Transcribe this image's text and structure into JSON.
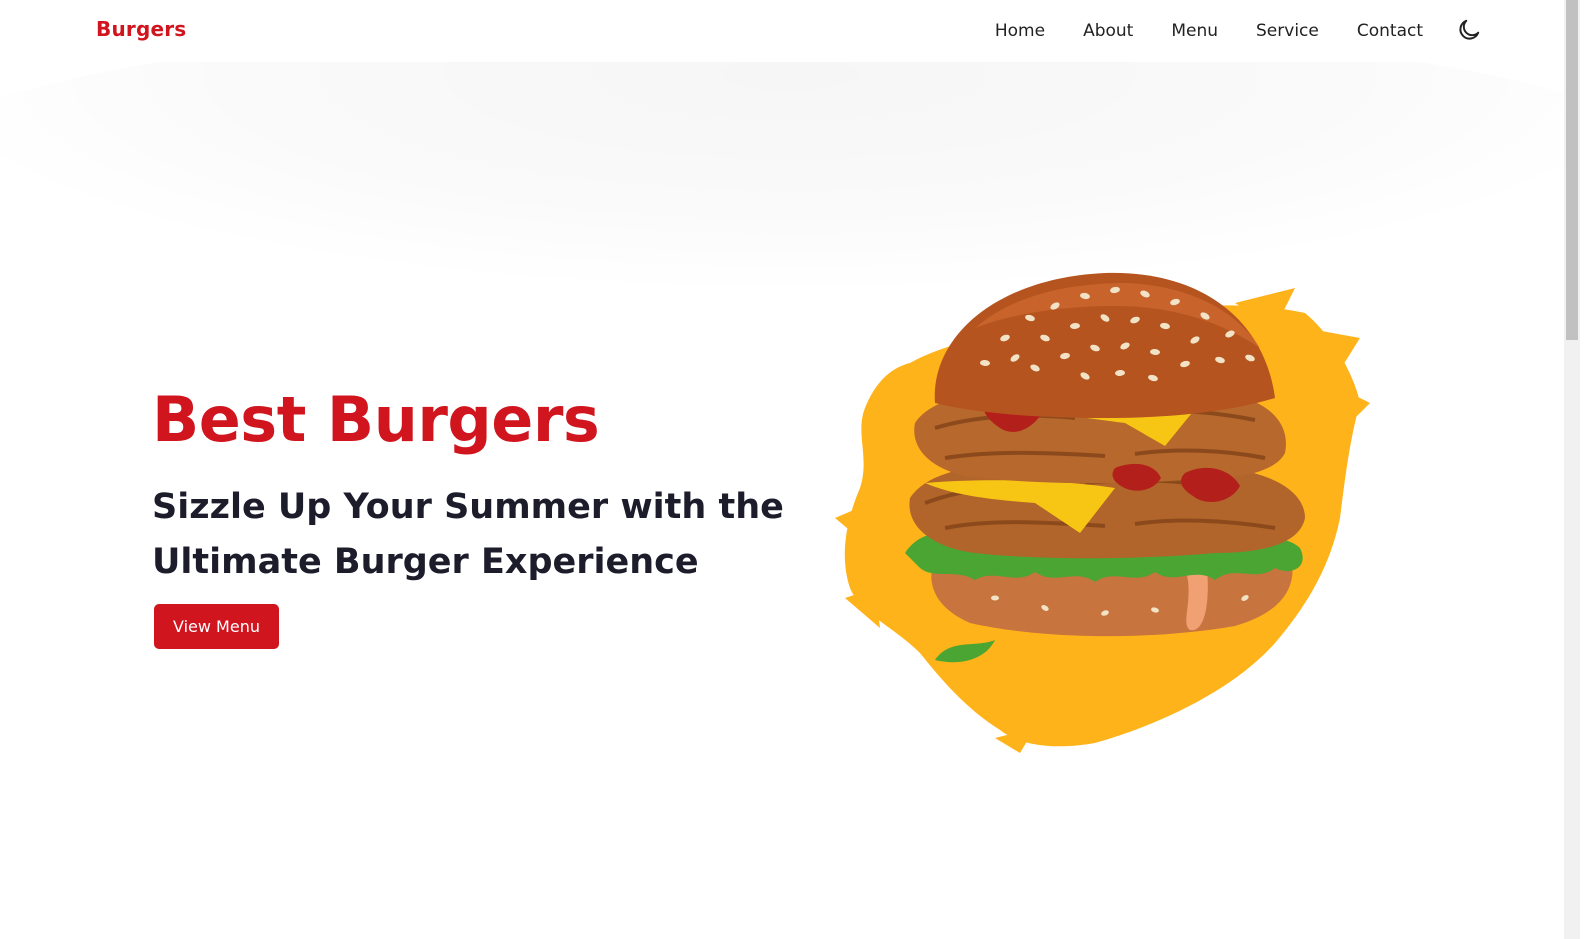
{
  "header": {
    "brand": "Burgers",
    "nav": [
      "Home",
      "About",
      "Menu",
      "Service",
      "Contact"
    ],
    "theme_toggle_icon": "moon-icon"
  },
  "hero": {
    "title": "Best Burgers",
    "subtitle": "Sizzle Up Your Summer with the Ultimate Burger Experience",
    "cta_label": "View Menu",
    "image_icon": "burger-illustration"
  },
  "colors": {
    "accent": "#d0151f",
    "text": "#1c1c2b",
    "splash": "#ffb31a"
  }
}
